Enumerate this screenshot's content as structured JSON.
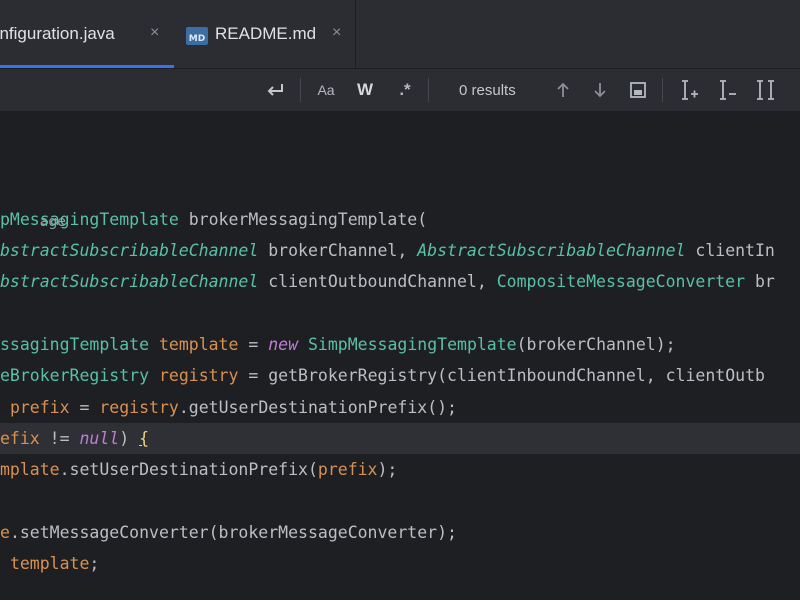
{
  "tabs": [
    {
      "label": "onfiguration.java",
      "close": "×",
      "active": true
    },
    {
      "label": "README.md",
      "close": "×",
      "icon_text": "MD",
      "active": false
    }
  ],
  "find_bar": {
    "results": "0 results",
    "icons": [
      "newline-icon",
      "match-case-icon",
      "whole-words-icon",
      "regex-icon",
      "up-arrow-icon",
      "down-arrow-icon",
      "in-selection-icon",
      "add-caret-icon",
      "remove-caret-icon",
      "select-all-occurrences-icon"
    ],
    "match_case_label": "Aa",
    "words_label": "W",
    "regex_label": ".*"
  },
  "code": {
    "line1": "age",
    "line2": [
      {
        "t": "pMessagingTemplate",
        "c": "type"
      },
      {
        "t": " brokerMessagingTemplate(",
        "c": "plain"
      }
    ],
    "line3": [
      {
        "t": "bstractSubscribableChannel",
        "c": "typei"
      },
      {
        "t": " brokerChannel, ",
        "c": "plain"
      },
      {
        "t": "AbstractSubscribableChannel",
        "c": "typei"
      },
      {
        "t": " clientIn",
        "c": "plain"
      }
    ],
    "line4": [
      {
        "t": "bstractSubscribableChannel",
        "c": "typei"
      },
      {
        "t": " clientOutboundChannel, ",
        "c": "plain"
      },
      {
        "t": "CompositeMessageConverter",
        "c": "type"
      },
      {
        "t": " br",
        "c": "plain"
      }
    ],
    "line5": [
      {
        "t": "ssagingTemplate",
        "c": "type"
      },
      {
        "t": " ",
        "c": "plain"
      },
      {
        "t": "template",
        "c": "param"
      },
      {
        "t": " = ",
        "c": "plain"
      },
      {
        "t": "new",
        "c": "kw"
      },
      {
        "t": " ",
        "c": "plain"
      },
      {
        "t": "SimpMessagingTemplate",
        "c": "type"
      },
      {
        "t": "(brokerChannel);",
        "c": "plain"
      }
    ],
    "line6": [
      {
        "t": "eBrokerRegistry",
        "c": "type"
      },
      {
        "t": " ",
        "c": "plain"
      },
      {
        "t": "registry",
        "c": "param"
      },
      {
        "t": " = getBrokerRegistry(clientInboundChannel, clientOutb",
        "c": "plain"
      }
    ],
    "line7": [
      {
        "t": " ",
        "c": "plain"
      },
      {
        "t": "prefix",
        "c": "param"
      },
      {
        "t": " = ",
        "c": "plain"
      },
      {
        "t": "registry",
        "c": "param"
      },
      {
        "t": ".getUserDestinationPrefix();",
        "c": "plain"
      }
    ],
    "line8": [
      {
        "t": "efix",
        "c": "param"
      },
      {
        "t": " != ",
        "c": "plain"
      },
      {
        "t": "null",
        "c": "kw"
      },
      {
        "t": ") ",
        "c": "plain"
      },
      {
        "t": "{",
        "c": "brace"
      }
    ],
    "line9": [
      {
        "t": "mplate",
        "c": "param"
      },
      {
        "t": ".setUserDestinationPrefix(",
        "c": "plain"
      },
      {
        "t": "prefix",
        "c": "param"
      },
      {
        "t": ");",
        "c": "plain"
      }
    ],
    "line10": [
      {
        "t": "e",
        "c": "param"
      },
      {
        "t": ".setMessageConverter(brokerMessageConverter);",
        "c": "plain"
      }
    ],
    "line11": [
      {
        "t": " ",
        "c": "plain"
      },
      {
        "t": "template",
        "c": "param"
      },
      {
        "t": ";",
        "c": "plain"
      }
    ]
  },
  "colors": {
    "accent": "#3574f0",
    "type": "#56c1a7",
    "param": "#d9914f",
    "keyword": "#c27bd6",
    "text": "#bcbec4"
  }
}
